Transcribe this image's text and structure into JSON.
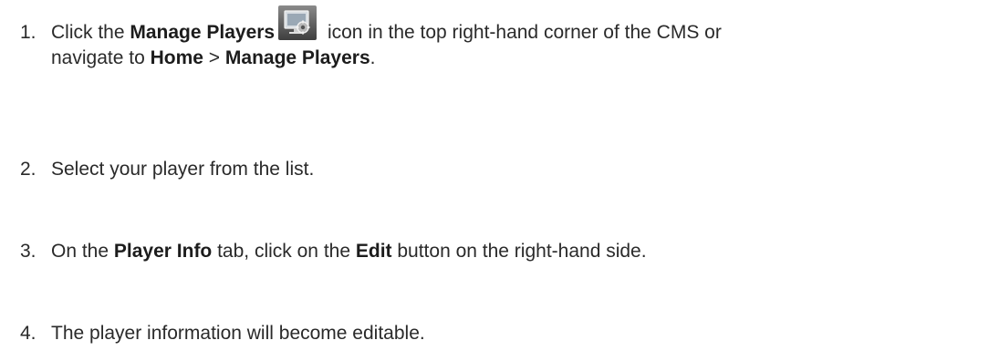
{
  "steps": [
    {
      "number": "1.",
      "t1": "Click the ",
      "b1": "Manage Players",
      "t2": " icon in the top right-hand corner of the CMS or",
      "t3": "navigate to ",
      "b2": "Home",
      "t4": " > ",
      "b3": "Manage Players",
      "t5": ".",
      "icon": "manage-players-icon"
    },
    {
      "number": "2.",
      "t1": "Select your player from the list."
    },
    {
      "number": "3.",
      "t1": "On the ",
      "b1": "Player Info",
      "t2": " tab, click on the ",
      "b2": "Edit",
      "t3": " button on the right-hand side."
    },
    {
      "number": "4.",
      "t1": "The player information will become editable."
    }
  ],
  "colors": {
    "text": "#2a2a2a",
    "icon_bg": "#5a5a5a"
  }
}
